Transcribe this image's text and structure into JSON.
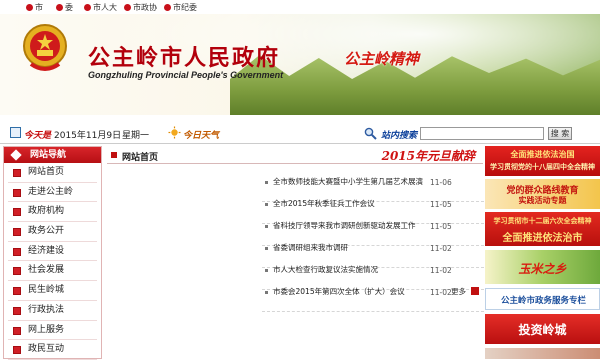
{
  "top_links": [
    "市",
    "委",
    "市人大",
    "市政协",
    "市纪委"
  ],
  "header": {
    "title": "公主岭市人民政府",
    "subtitle": "Gongzhuling Provincial People's Government",
    "slogan": "公主岭精神"
  },
  "datebar": {
    "today_label": "今天是",
    "date": "2015年11月9日",
    "weekday": "星期一",
    "weather_label": "今日天气",
    "search_label": "站内搜索",
    "search_value": "",
    "search_button": "搜 索"
  },
  "sidebar": {
    "title": "网站导航",
    "items": [
      "网站首页",
      "走进公主岭",
      "政府机构",
      "政务公开",
      "经济建设",
      "社会发展",
      "民生岭城",
      "行政执法",
      "网上服务",
      "政民互动"
    ]
  },
  "main": {
    "breadcrumb": "网站首页",
    "headline": "2015年元旦献辞",
    "news": [
      {
        "title": "全市数师技能大赛暨中小学生第几届艺术展演",
        "date": "11-06"
      },
      {
        "title": "全市2015年秋季征兵工作会议",
        "date": "11-05"
      },
      {
        "title": "省科技厅领导来我市调研创新驱动发展工作",
        "date": "11-05"
      },
      {
        "title": "省委调研组来我市调研",
        "date": "11-02"
      },
      {
        "title": "市人大检查行政复议法实施情况",
        "date": "11-02"
      },
      {
        "title": "市委会2015年第四次全体（扩大）会议",
        "date": "11-02"
      }
    ],
    "more": "更多"
  },
  "right_banners": [
    {
      "l1": "全面推进依法治国",
      "l2": "学习贯彻党的十八届四中全会精神"
    },
    {
      "l1": "党的群众路线教育",
      "l2": "实践活动专题"
    },
    {
      "l1": "学习贯彻市十二届六次全会精神",
      "l2": "全面推进依法治市"
    },
    {
      "l1": "玉米之乡"
    },
    {
      "l1": "公主岭市政务服务专栏"
    },
    {
      "l1": "投资岭城"
    }
  ],
  "colors": {
    "brand_red": "#c8101a",
    "nav_blue": "#0b3f9a"
  }
}
